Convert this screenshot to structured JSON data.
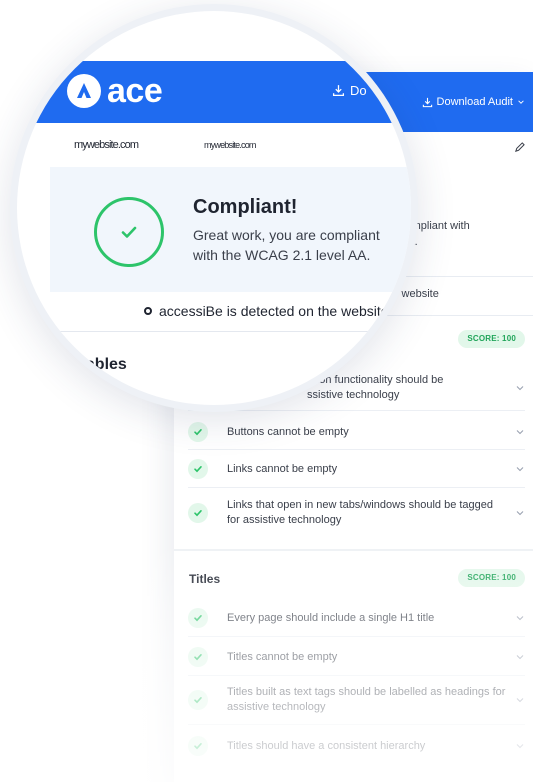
{
  "header": {
    "logo_text": "ace",
    "download_label": "Download Audit",
    "download_partial": "Do",
    "brand_color": "#1f6bf0"
  },
  "site": {
    "name": "mywebsite.com"
  },
  "compliance": {
    "title": "Compliant!",
    "message": "Great work, you are compliant with the WCAG 2.1 level AA.",
    "panel_line1": "compliant with",
    "panel_line2": "AA.",
    "status_color": "#2dc46a"
  },
  "detection": {
    "text": "accessiBe is detected on the website",
    "panel_fragment": "n the website"
  },
  "sections": [
    {
      "title": "Clickables",
      "title_visible": "kables",
      "score": "SCORE: 100",
      "items": [
        {
          "line1": "utton functionality should be",
          "line2": "ssistive technology"
        },
        {
          "text": "Buttons cannot be empty"
        },
        {
          "text": "Links cannot be empty"
        },
        {
          "text": "Links that open in new tabs/windows should be tagged for assistive technology"
        }
      ]
    },
    {
      "title": "Titles",
      "score": "SCORE: 100",
      "items": [
        {
          "text": "Every page should include a single H1 title"
        },
        {
          "text": "Titles cannot be empty"
        },
        {
          "text": "Titles built as text tags should be labelled as headings for assistive technology"
        },
        {
          "text": "Titles should have a consistent hierarchy"
        }
      ]
    }
  ],
  "icons": {
    "download": "download-icon",
    "chevron": "chevron-down-icon",
    "edit": "pencil-icon",
    "check": "check-icon"
  }
}
